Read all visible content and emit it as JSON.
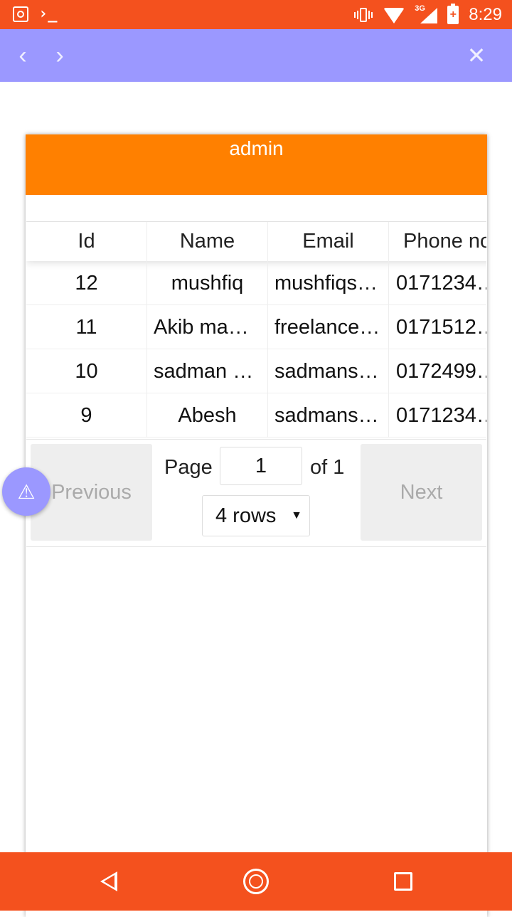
{
  "status_bar": {
    "time": "8:29",
    "network": "3G",
    "terminal_glyph": "›_",
    "icons": [
      "app-icon",
      "terminal-icon",
      "vibrate-icon",
      "wifi-icon",
      "signal-icon",
      "battery-charging-icon"
    ]
  },
  "top_nav": {
    "back_glyph": "‹",
    "forward_glyph": "›",
    "close_glyph": "✕",
    "color": "#9b98ff"
  },
  "card": {
    "title": "admin",
    "header_color": "#ff8000"
  },
  "table": {
    "columns": [
      "Id",
      "Name",
      "Email",
      "Phone no"
    ],
    "rows": [
      {
        "id": "12",
        "name": "mushfiq",
        "email": "mushfiqs…",
        "phone": "0171234…"
      },
      {
        "id": "11",
        "name": "Akib ma…",
        "email": "freelance…",
        "phone": "0171512…"
      },
      {
        "id": "10",
        "name": "sadman …",
        "email": "sadmans…",
        "phone": "0172499…"
      },
      {
        "id": "9",
        "name": "Abesh",
        "email": "sadmans…",
        "phone": "0171234…"
      }
    ]
  },
  "pagination": {
    "previous_label": "Previous",
    "next_label": "Next",
    "page_label": "Page",
    "page_value": "1",
    "of_label": "of 1",
    "rows_value": "4 rows",
    "caret": "▼"
  },
  "fab": {
    "glyph": "⚠"
  },
  "accent_colors": {
    "status_bar": "#f4511e",
    "bottom_nav": "#f4511e"
  }
}
